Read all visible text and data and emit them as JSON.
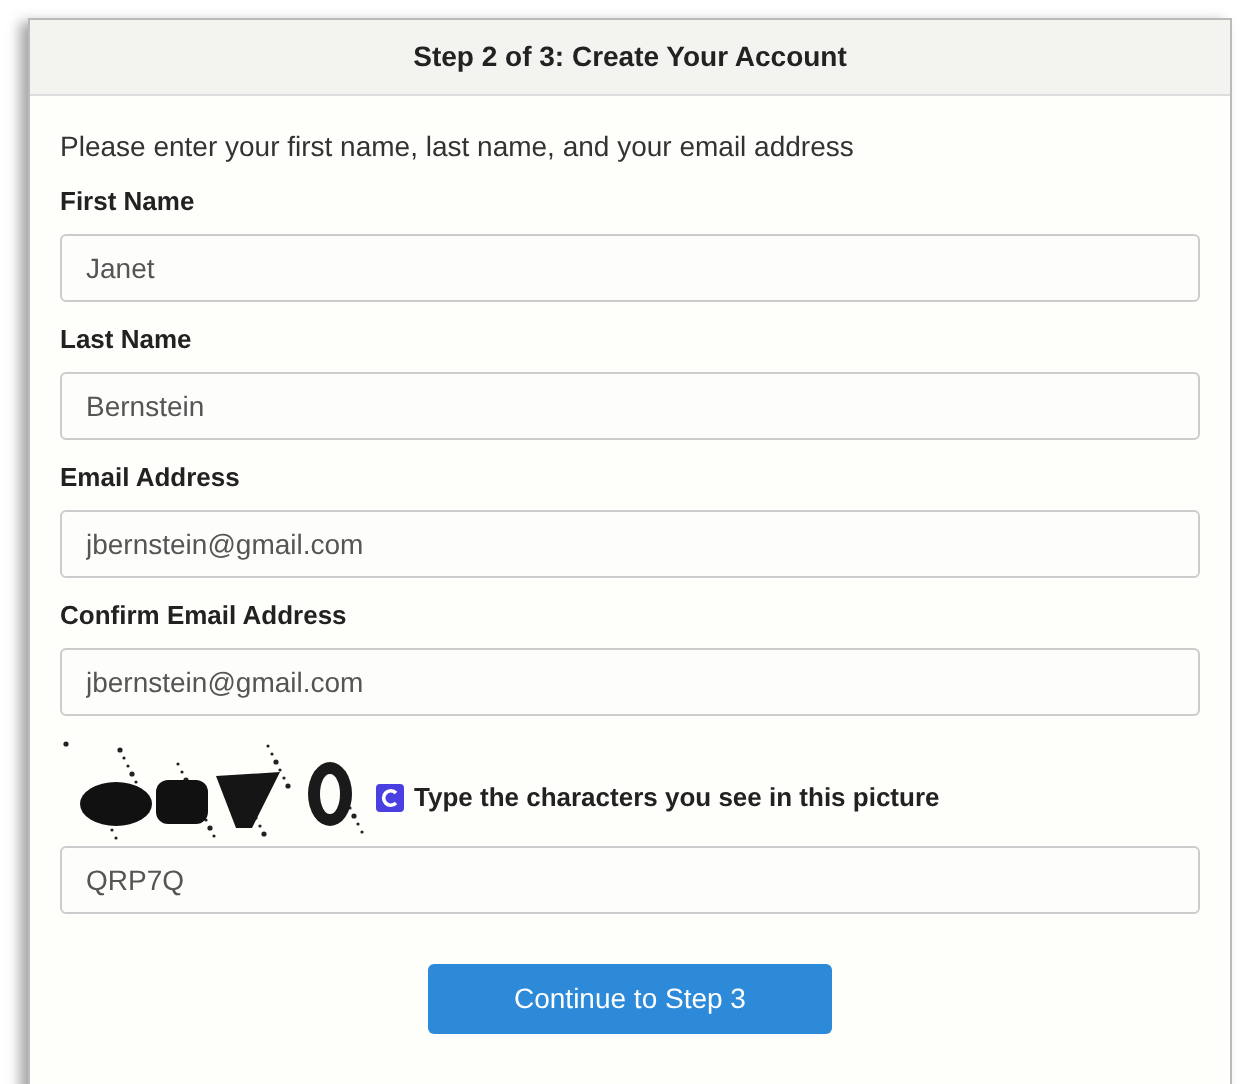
{
  "panel": {
    "title": "Step 2 of 3: Create Your Account"
  },
  "intro": "Please enter your first name, last name, and your email address",
  "fields": [
    {
      "label": "First Name",
      "value": "Janet"
    },
    {
      "label": "Last Name",
      "value": "Bernstein"
    },
    {
      "label": "Email Address",
      "value": "jbernstein@gmail.com"
    },
    {
      "label": "Confirm Email Address",
      "value": "jbernstein@gmail.com"
    }
  ],
  "captcha": {
    "prompt": "Type the characters you see in this picture",
    "value": "QRP7Q"
  },
  "submit": "Continue to Step 3"
}
